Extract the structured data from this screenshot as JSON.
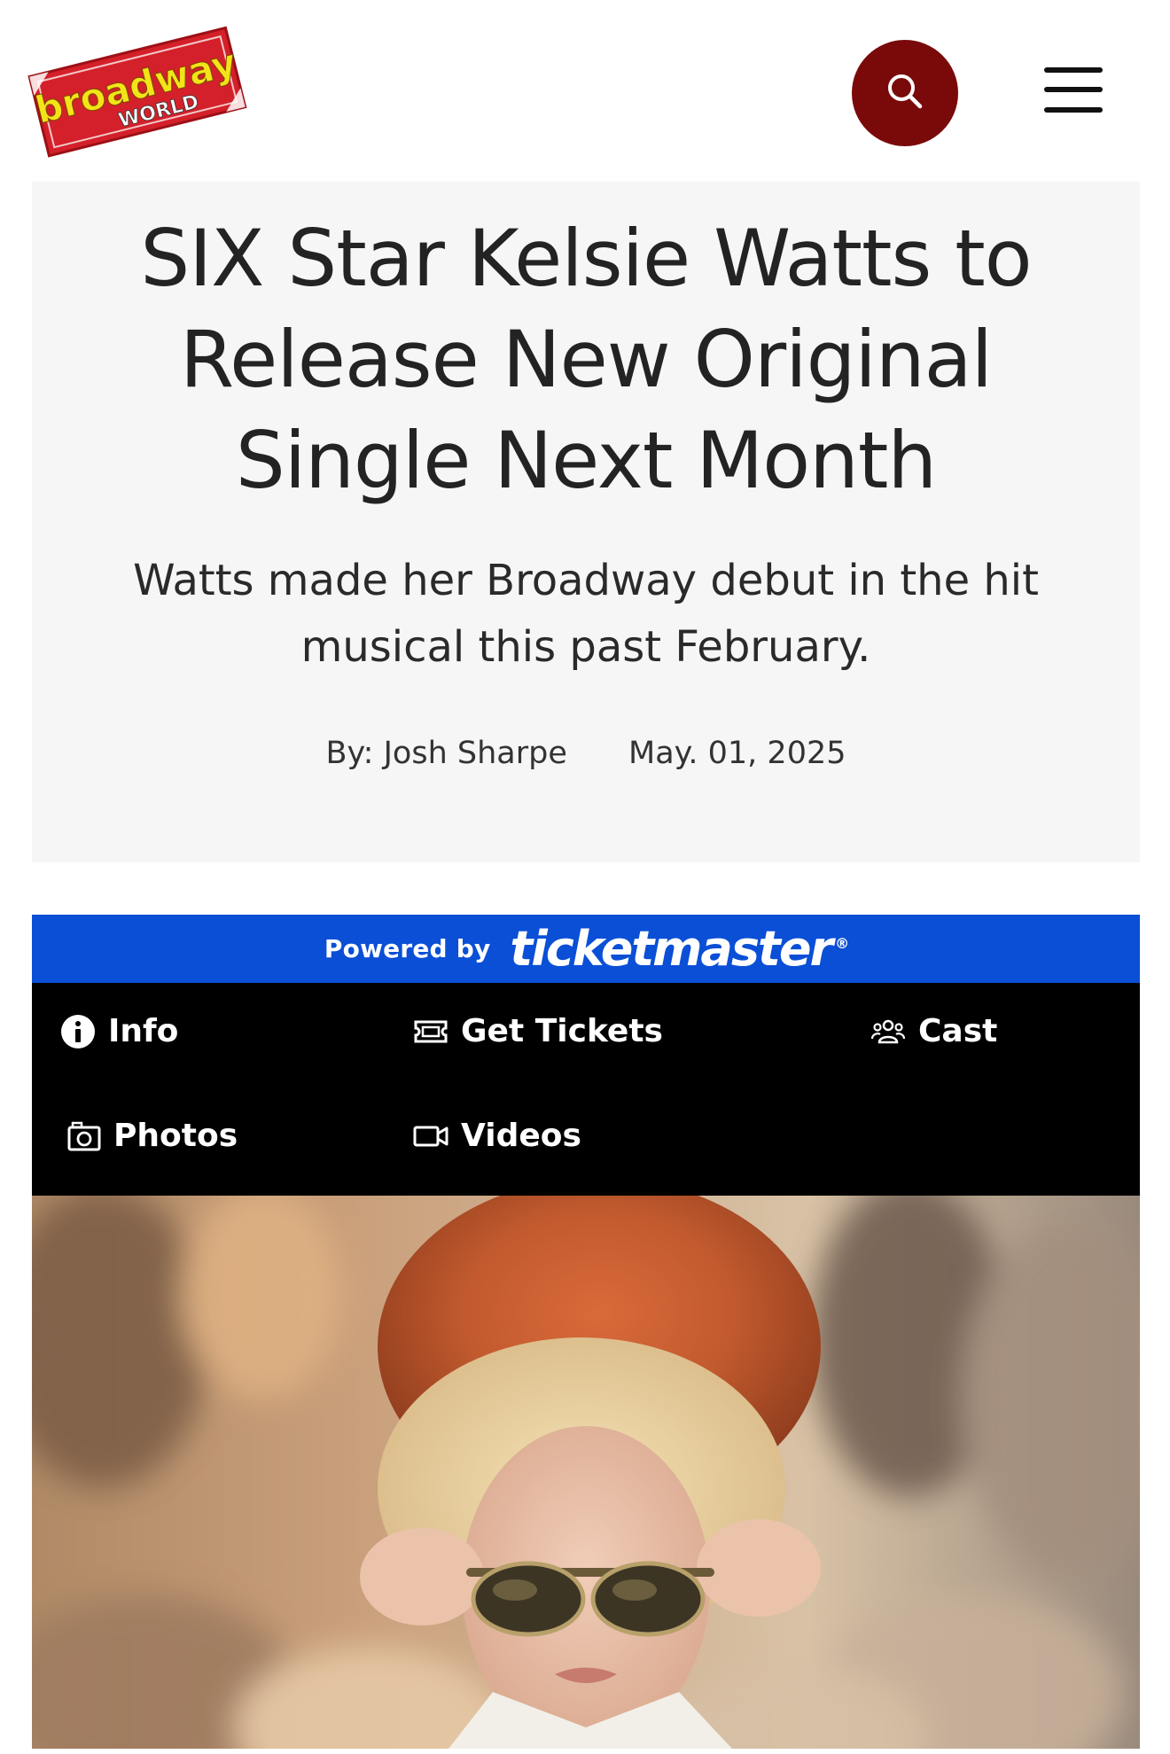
{
  "header": {
    "logo": {
      "line1": "broadway",
      "line2": "WORLD"
    },
    "search_icon": "search-icon",
    "menu_icon": "hamburger-menu-icon"
  },
  "article": {
    "headline": "SIX Star Kelsie Watts to Release New Original Single Next Month",
    "subheadline": "Watts made her Broadway debut in the hit musical this past February.",
    "author": "By: Josh Sharpe",
    "date": "May. 01, 2025"
  },
  "ticketmaster": {
    "powered_by": "Powered by",
    "brand": "ticketmaster",
    "registered": "®",
    "colors": {
      "bar": "#0a4fd6",
      "nav": "#000000"
    },
    "nav": [
      {
        "label": "Info",
        "icon": "info-icon"
      },
      {
        "label": "Get Tickets",
        "icon": "ticket-icon"
      },
      {
        "label": "Cast",
        "icon": "people-icon"
      },
      {
        "label": "Photos",
        "icon": "camera-icon"
      },
      {
        "label": "Videos",
        "icon": "video-icon"
      }
    ]
  },
  "colors": {
    "brand_red": "#d4202a",
    "search_button": "#7a0a0a",
    "card_background": "#f6f6f6"
  }
}
